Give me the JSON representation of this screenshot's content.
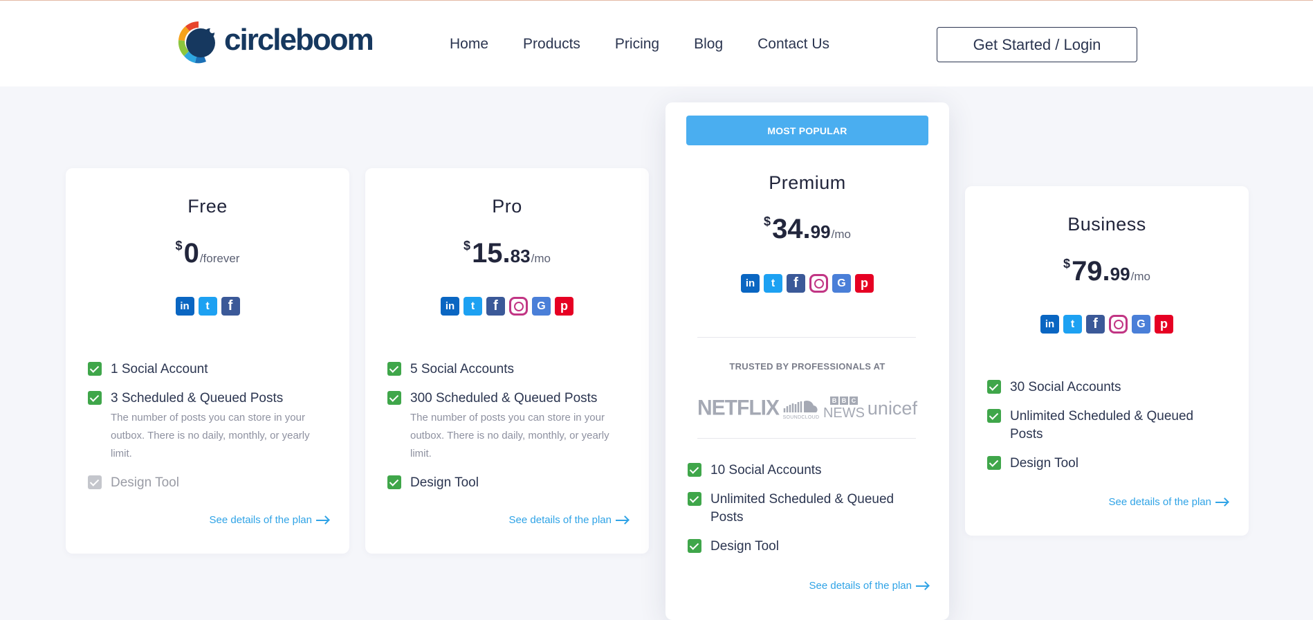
{
  "header": {
    "logo_text": "circleboom",
    "nav": [
      {
        "label": "Home"
      },
      {
        "label": "Products"
      },
      {
        "label": "Pricing"
      },
      {
        "label": "Blog"
      },
      {
        "label": "Contact Us"
      }
    ],
    "cta_label": "Get Started / Login"
  },
  "colors": {
    "brand_navy": "#16385f",
    "badge_blue": "#4aaef0",
    "check_green": "#3fa64a",
    "link_blue": "#2fa3e6",
    "page_bg": "#f5f6fa"
  },
  "plans": [
    {
      "name": "Free",
      "currency": "$",
      "price_int": "0",
      "price_dec": "",
      "period": "/forever",
      "networks": [
        "linkedin-icon",
        "twitter-icon",
        "facebook-icon"
      ],
      "features": [
        {
          "text": "1 Social Account",
          "enabled": true
        },
        {
          "text": "3 Scheduled & Queued Posts",
          "enabled": true,
          "note": "The number of posts you can store in your outbox. There is no daily, monthly, or yearly limit."
        },
        {
          "text": "Design Tool",
          "enabled": false
        }
      ],
      "details_label": "See details of the plan"
    },
    {
      "name": "Pro",
      "currency": "$",
      "price_int": "15.",
      "price_dec": "83",
      "period": "/mo",
      "networks": [
        "linkedin-icon",
        "twitter-icon",
        "facebook-icon",
        "instagram-icon",
        "google-business-icon",
        "pinterest-icon"
      ],
      "features": [
        {
          "text": "5 Social Accounts",
          "enabled": true
        },
        {
          "text": "300 Scheduled & Queued Posts",
          "enabled": true,
          "note": "The number of posts you can store in your outbox. There is no daily, monthly, or yearly limit."
        },
        {
          "text": "Design Tool",
          "enabled": true
        }
      ],
      "details_label": "See details of the plan"
    },
    {
      "name": "Premium",
      "badge": "MOST POPULAR",
      "currency": "$",
      "price_int": "34.",
      "price_dec": "99",
      "period": "/mo",
      "networks": [
        "linkedin-icon",
        "twitter-icon",
        "facebook-icon",
        "instagram-icon",
        "google-business-icon",
        "pinterest-icon"
      ],
      "trusted_label": "TRUSTED BY PROFESSIONALS AT",
      "brands": {
        "netflix": "NETFLIX",
        "soundcloud": "SOUNDCLOUD",
        "bbc_letters": [
          "B",
          "B",
          "C"
        ],
        "bbc_news": "NEWS",
        "unicef": "unicef"
      },
      "features": [
        {
          "text": "10 Social Accounts",
          "enabled": true
        },
        {
          "text": "Unlimited Scheduled & Queued Posts",
          "enabled": true
        },
        {
          "text": "Design Tool",
          "enabled": true
        }
      ],
      "details_label": "See details of the plan"
    },
    {
      "name": "Business",
      "currency": "$",
      "price_int": "79.",
      "price_dec": "99",
      "period": "/mo",
      "networks": [
        "linkedin-icon",
        "twitter-icon",
        "facebook-icon",
        "instagram-icon",
        "google-business-icon",
        "pinterest-icon"
      ],
      "features": [
        {
          "text": "30 Social Accounts",
          "enabled": true
        },
        {
          "text": "Unlimited Scheduled & Queued Posts",
          "enabled": true
        },
        {
          "text": "Design Tool",
          "enabled": true
        }
      ],
      "details_label": "See details of the plan"
    }
  ]
}
